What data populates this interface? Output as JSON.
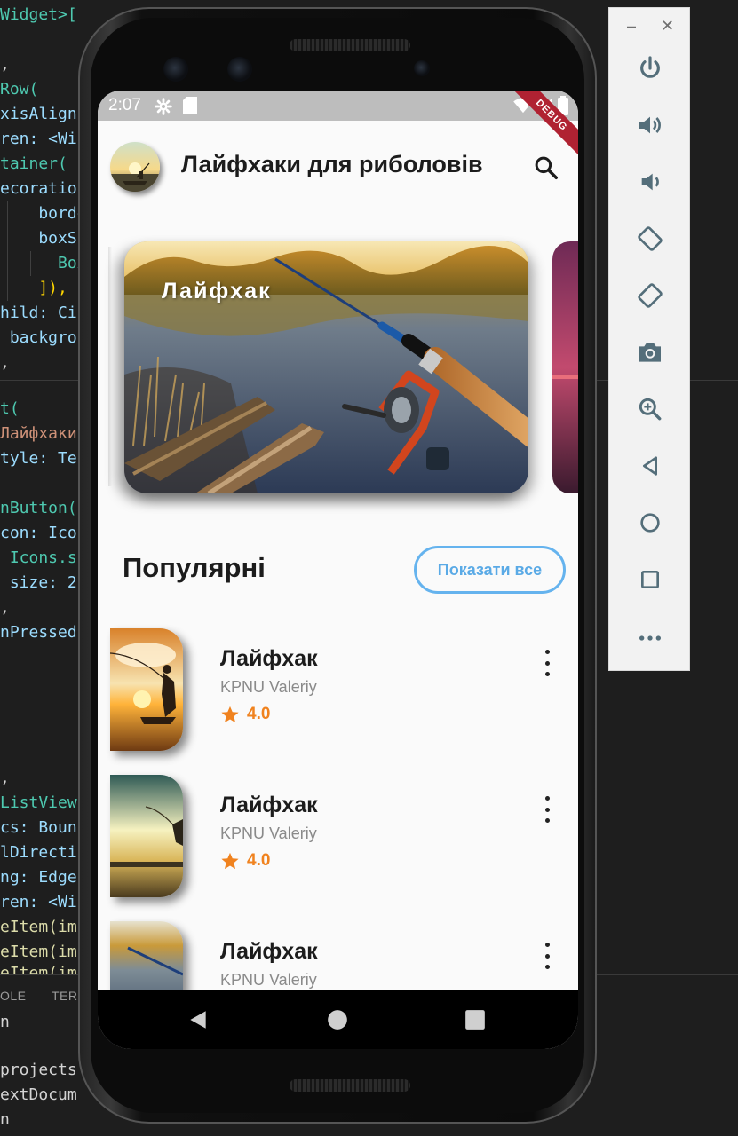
{
  "editor": {
    "lines": [
      "Widget>[",
      ",",
      "Row(",
      "xisAlign",
      "ren: <Wi",
      "tainer(",
      "ecoratio",
      "    borde",
      "    boxSh",
      "      Box",
      "    ]),",
      "hild: Ci",
      " backgro",
      ",",
      "t(",
      "Лайфхаки",
      "tyle: Te",
      "nButton(",
      "con: Ico",
      " Icons.s",
      " size: 2",
      ",",
      "nPressed",
      ",",
      "ListView",
      "cs: Boun",
      "lDirecti",
      "ng: Edge",
      "ren: <Wi",
      "eItem(im",
      "eItem(im",
      "eItem(im",
      "n",
      "projects",
      "extDocum",
      "n"
    ],
    "panel_tabs": [
      "OLE",
      "TER"
    ]
  },
  "emulator": {
    "window_controls": {
      "minimize": "–",
      "close": "✕"
    },
    "tools": [
      "power-icon",
      "volume-up-icon",
      "volume-down-icon",
      "rotate-left-icon",
      "rotate-right-icon",
      "camera-icon",
      "zoom-icon",
      "back-icon",
      "home-icon",
      "overview-icon",
      "more-icon"
    ]
  },
  "status_bar": {
    "time": "2:07",
    "debug_banner": "DEBUG"
  },
  "app_bar": {
    "title": "Лайфхаки для риболовів"
  },
  "featured": {
    "cards": [
      {
        "title": "Лайфхак"
      }
    ]
  },
  "popular": {
    "heading": "Популярні",
    "show_all_label": "Показати все",
    "items": [
      {
        "title": "Лайфхак",
        "author": "KPNU Valeriy",
        "rating": "4.0"
      },
      {
        "title": "Лайфхак",
        "author": "KPNU Valeriy",
        "rating": "4.0"
      },
      {
        "title": "Лайфхак",
        "author": "KPNU Valeriy",
        "rating": ""
      }
    ]
  },
  "colors": {
    "accent_blue": "#65b3ee",
    "rating_orange": "#f0821e",
    "debug_red": "#b02232",
    "status_bar_gray": "#bdbdbd"
  }
}
